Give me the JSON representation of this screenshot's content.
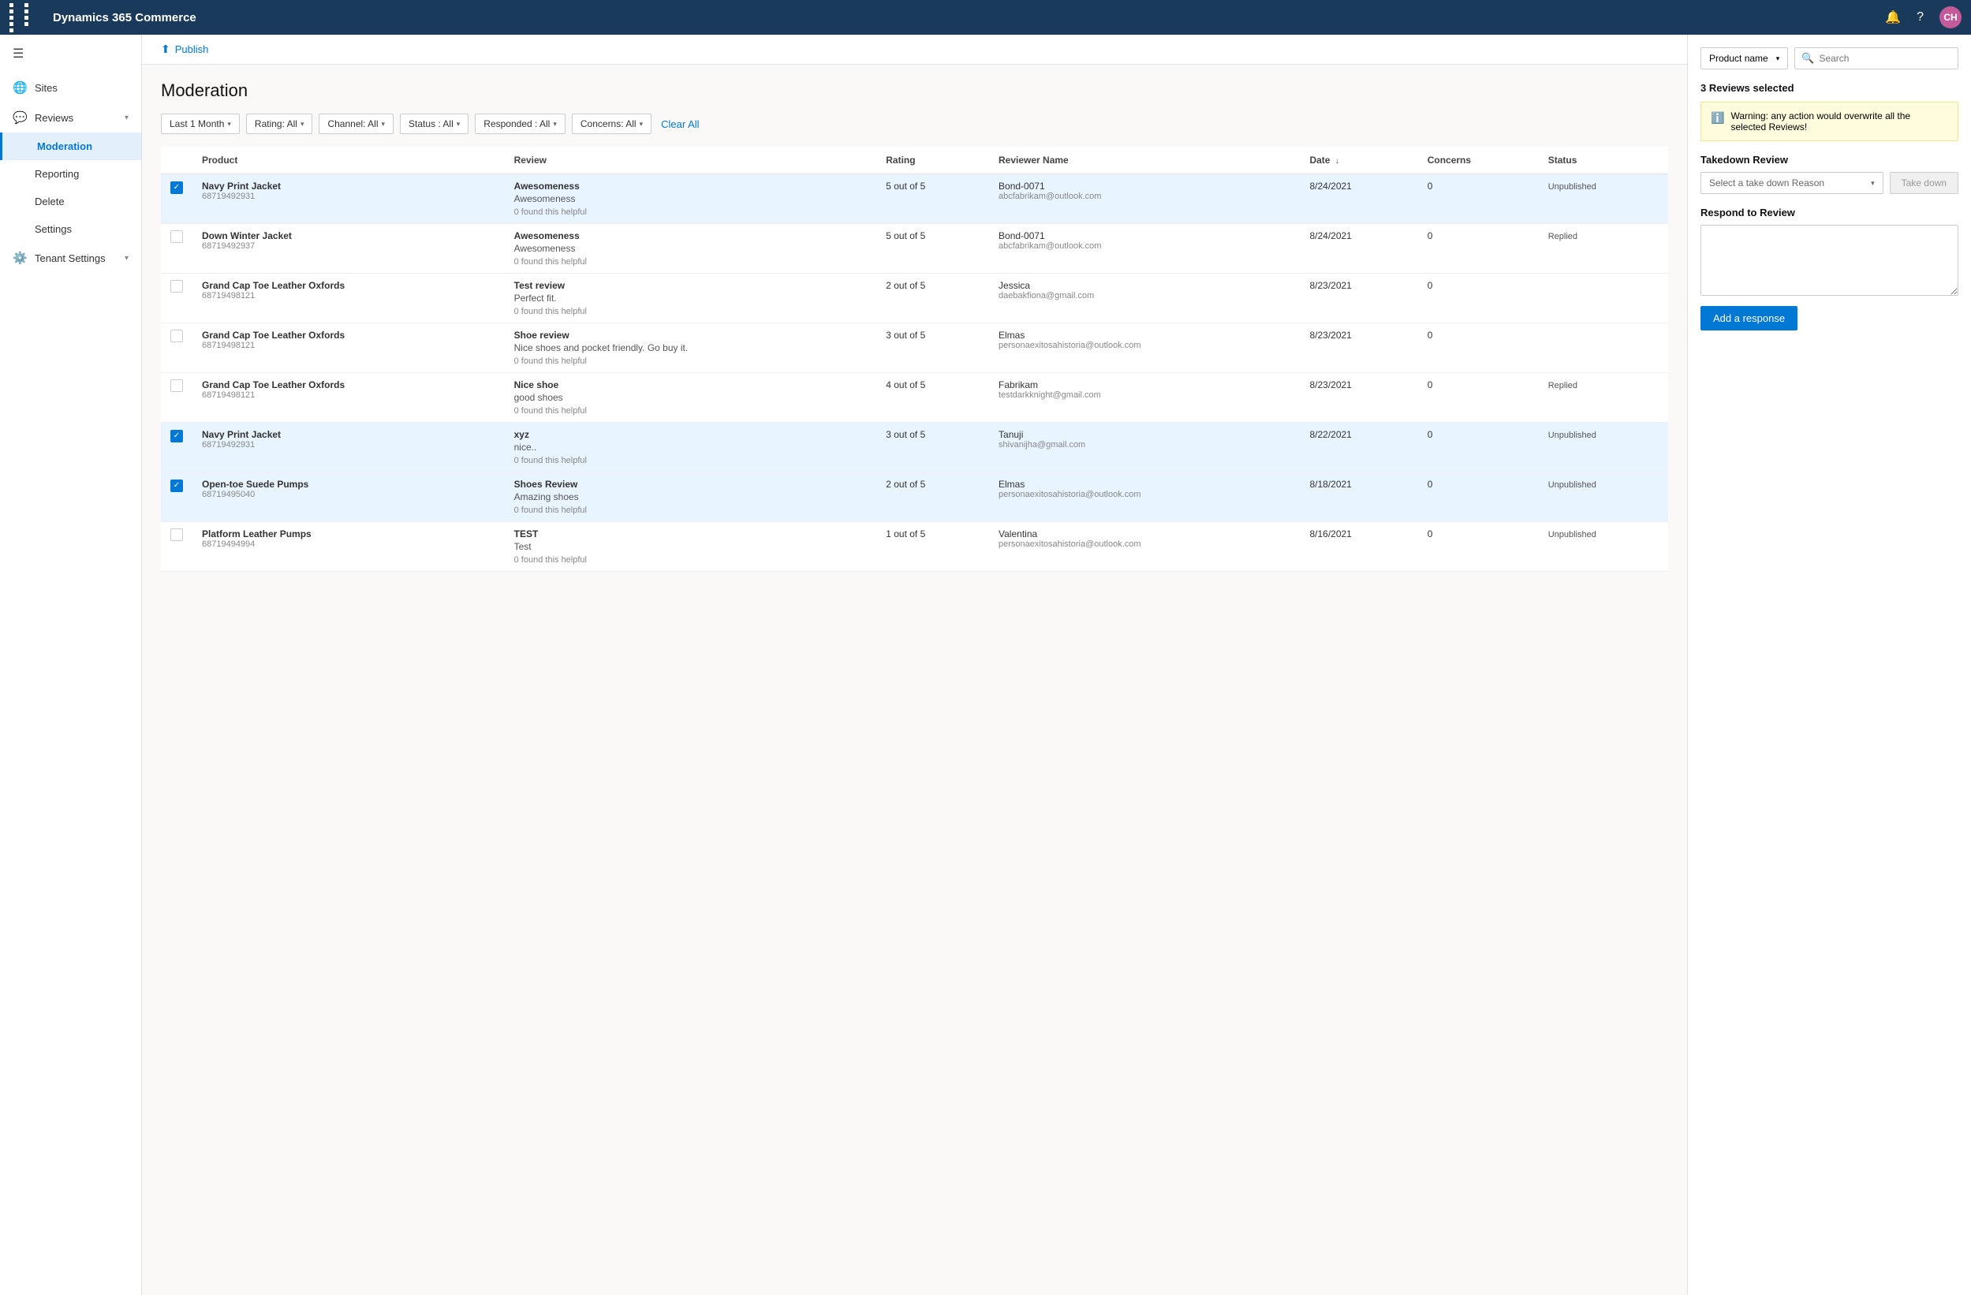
{
  "app": {
    "title": "Dynamics 365 Commerce",
    "user_initials": "CH"
  },
  "topnav": {
    "title": "Dynamics 365 Commerce",
    "notification_icon": "🔔",
    "help_icon": "?",
    "user_initials": "CH"
  },
  "sidebar": {
    "hamburger_icon": "☰",
    "items": [
      {
        "id": "sites",
        "label": "Sites",
        "icon": "🌐",
        "active": false
      },
      {
        "id": "reviews",
        "label": "Reviews",
        "icon": "💬",
        "active": false,
        "has_chevron": true
      },
      {
        "id": "moderation",
        "label": "Moderation",
        "active": true,
        "indent": true
      },
      {
        "id": "reporting",
        "label": "Reporting",
        "active": false,
        "indent": true
      },
      {
        "id": "delete",
        "label": "Delete",
        "active": false,
        "indent": true
      },
      {
        "id": "settings",
        "label": "Settings",
        "active": false,
        "indent": true
      },
      {
        "id": "tenant-settings",
        "label": "Tenant Settings",
        "icon": "⚙️",
        "active": false,
        "has_chevron": true
      }
    ]
  },
  "publish_bar": {
    "button_label": "Publish"
  },
  "page": {
    "title": "Moderation"
  },
  "filters": {
    "date_filter": "Last 1 Month",
    "rating_filter": "Rating: All",
    "channel_filter": "Channel: All",
    "status_filter": "Status : All",
    "responded_filter": "Responded : All",
    "concerns_filter": "Concerns: All",
    "clear_all_label": "Clear All"
  },
  "table": {
    "columns": [
      {
        "id": "checkbox",
        "label": ""
      },
      {
        "id": "product",
        "label": "Product"
      },
      {
        "id": "review",
        "label": "Review"
      },
      {
        "id": "rating",
        "label": "Rating"
      },
      {
        "id": "reviewer",
        "label": "Reviewer Name"
      },
      {
        "id": "date",
        "label": "Date"
      },
      {
        "id": "concerns",
        "label": "Concerns"
      },
      {
        "id": "status",
        "label": "Status"
      }
    ],
    "rows": [
      {
        "id": 1,
        "selected": true,
        "product_name": "Navy Print Jacket",
        "product_id": "68719492931",
        "review_title": "Awesomeness",
        "review_body": "Awesomeness",
        "helpful_count": "0",
        "rating": "5 out of 5",
        "reviewer_name": "Bond-0071",
        "reviewer_email": "abcfabrikam@outlook.com",
        "date": "8/24/2021",
        "concerns": "0",
        "status": "Unpublished"
      },
      {
        "id": 2,
        "selected": false,
        "product_name": "Down Winter Jacket",
        "product_id": "68719492937",
        "review_title": "Awesomeness",
        "review_body": "Awesomeness",
        "helpful_count": "0",
        "rating": "5 out of 5",
        "reviewer_name": "Bond-0071",
        "reviewer_email": "abcfabrikam@outlook.com",
        "date": "8/24/2021",
        "concerns": "0",
        "status": "Replied"
      },
      {
        "id": 3,
        "selected": false,
        "product_name": "Grand Cap Toe Leather Oxfords",
        "product_id": "68719498121",
        "review_title": "Test review",
        "review_body": "Perfect fit.",
        "helpful_count": "0",
        "rating": "2 out of 5",
        "reviewer_name": "Jessica",
        "reviewer_email": "daebakfiona@gmail.com",
        "date": "8/23/2021",
        "concerns": "0",
        "status": ""
      },
      {
        "id": 4,
        "selected": false,
        "product_name": "Grand Cap Toe Leather Oxfords",
        "product_id": "68719498121",
        "review_title": "Shoe review",
        "review_body": "Nice shoes and pocket friendly. Go buy it.",
        "helpful_count": "0",
        "rating": "3 out of 5",
        "reviewer_name": "Elmas",
        "reviewer_email": "personaexitosahistoria@outlook.com",
        "date": "8/23/2021",
        "concerns": "0",
        "status": ""
      },
      {
        "id": 5,
        "selected": false,
        "product_name": "Grand Cap Toe Leather Oxfords",
        "product_id": "68719498121",
        "review_title": "Nice shoe",
        "review_body": "good shoes",
        "helpful_count": "0",
        "rating": "4 out of 5",
        "reviewer_name": "Fabrikam",
        "reviewer_email": "testdarkknight@gmail.com",
        "date": "8/23/2021",
        "concerns": "0",
        "status": "Replied"
      },
      {
        "id": 6,
        "selected": true,
        "product_name": "Navy Print Jacket",
        "product_id": "68719492931",
        "review_title": "xyz",
        "review_body": "nice..",
        "helpful_count": "0",
        "rating": "3 out of 5",
        "reviewer_name": "Tanuji",
        "reviewer_email": "shivanijha@gmail.com",
        "date": "8/22/2021",
        "concerns": "0",
        "status": "Unpublished"
      },
      {
        "id": 7,
        "selected": true,
        "product_name": "Open-toe Suede Pumps",
        "product_id": "68719495040",
        "review_title": "Shoes Review",
        "review_body": "Amazing shoes",
        "helpful_count": "0",
        "rating": "2 out of 5",
        "reviewer_name": "Elmas",
        "reviewer_email": "personaexitosahistoria@outlook.com",
        "date": "8/18/2021",
        "concerns": "0",
        "status": "Unpublished"
      },
      {
        "id": 8,
        "selected": false,
        "product_name": "Platform Leather Pumps",
        "product_id": "68719494994",
        "review_title": "TEST",
        "review_body": "Test",
        "helpful_count": "0",
        "rating": "1 out of 5",
        "reviewer_name": "Valentina",
        "reviewer_email": "personaexitosahistoria@outlook.com",
        "date": "8/16/2021",
        "concerns": "0",
        "status": "Unpublished"
      }
    ]
  },
  "right_panel": {
    "product_name_label": "Product name",
    "search_placeholder": "Search",
    "reviews_selected_label": "3 Reviews selected",
    "warning_text": "Warning: any action would overwrite all the selected Reviews!",
    "takedown_section_title": "Takedown Review",
    "takedown_placeholder": "Select a take down Reason",
    "takedown_btn_label": "Take down",
    "respond_section_title": "Respond to Review",
    "respond_placeholder": "",
    "add_response_btn_label": "Add a response"
  }
}
